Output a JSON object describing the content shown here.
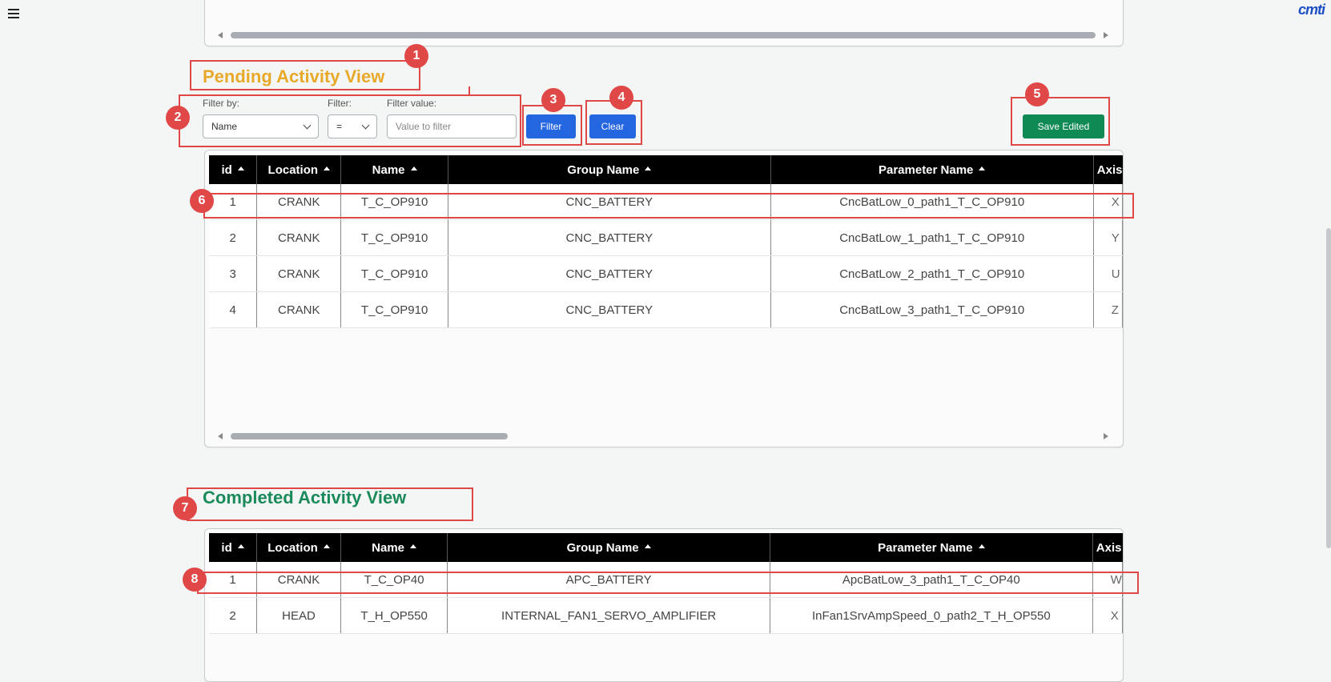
{
  "header": {
    "logo_text": "cmti",
    "menu_icon": "hamburger-icon"
  },
  "pending": {
    "title": "Pending Activity View",
    "filter": {
      "filter_by_label": "Filter by:",
      "filter_by_value": "Name",
      "operator_label": "Filter:",
      "operator_value": "=",
      "value_label": "Filter value:",
      "value_placeholder": "Value to filter",
      "filter_button": "Filter",
      "clear_button": "Clear"
    },
    "save_button": "Save Edited",
    "columns": [
      "id",
      "Location",
      "Name",
      "Group Name",
      "Parameter Name",
      "Axis"
    ],
    "rows": [
      {
        "id": "1",
        "location": "CRANK",
        "name": "T_C_OP910",
        "group": "CNC_BATTERY",
        "param": "CncBatLow_0_path1_T_C_OP910",
        "axis": "X"
      },
      {
        "id": "2",
        "location": "CRANK",
        "name": "T_C_OP910",
        "group": "CNC_BATTERY",
        "param": "CncBatLow_1_path1_T_C_OP910",
        "axis": "Y"
      },
      {
        "id": "3",
        "location": "CRANK",
        "name": "T_C_OP910",
        "group": "CNC_BATTERY",
        "param": "CncBatLow_2_path1_T_C_OP910",
        "axis": "U"
      },
      {
        "id": "4",
        "location": "CRANK",
        "name": "T_C_OP910",
        "group": "CNC_BATTERY",
        "param": "CncBatLow_3_path1_T_C_OP910",
        "axis": "Z"
      }
    ]
  },
  "completed": {
    "title": "Completed Activity View",
    "columns": [
      "id",
      "Location",
      "Name",
      "Group Name",
      "Parameter Name",
      "Axis"
    ],
    "rows": [
      {
        "id": "1",
        "location": "CRANK",
        "name": "T_C_OP40",
        "group": "APC_BATTERY",
        "param": "ApcBatLow_3_path1_T_C_OP40",
        "axis": "W"
      },
      {
        "id": "2",
        "location": "HEAD",
        "name": "T_H_OP550",
        "group": "INTERNAL_FAN1_SERVO_AMPLIFIER",
        "param": "InFan1SrvAmpSpeed_0_path2_T_H_OP550",
        "axis": "X"
      }
    ]
  },
  "annotations": [
    "1",
    "2",
    "3",
    "4",
    "5",
    "6",
    "7",
    "8"
  ],
  "colors": {
    "pending_title": "#e8a92a",
    "completed_title": "#1b8a5a",
    "annotation": "#e04848",
    "primary": "#2466e0",
    "success": "#108a55"
  }
}
